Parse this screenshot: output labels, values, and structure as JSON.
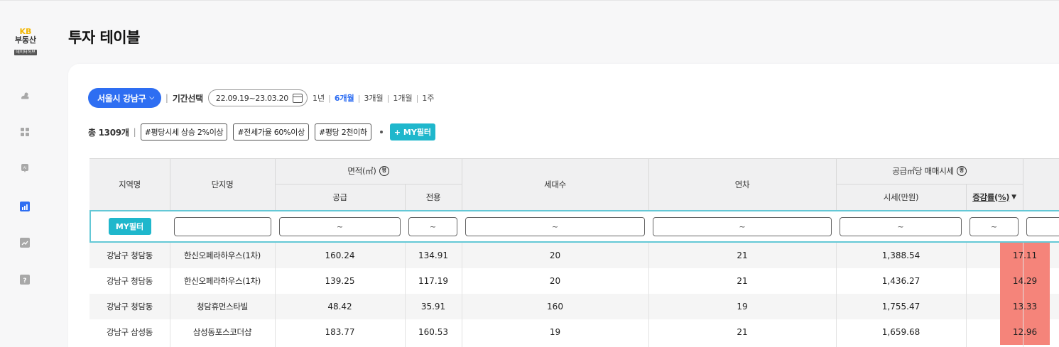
{
  "logo": {
    "line1": "KB",
    "line2": "부동산",
    "line3": "데이터허브"
  },
  "nav_icons": [
    "weather-icon",
    "grid-icon",
    "ai-icon",
    "chart-bar-icon",
    "trend-icon",
    "question-icon"
  ],
  "title": "투자 테이블",
  "filters": {
    "region": "서울시 강남구",
    "period_label": "기간선택",
    "date_range": "22.09.19~23.03.20",
    "periods": [
      {
        "label": "1년",
        "active": false
      },
      {
        "label": "6개월",
        "active": true
      },
      {
        "label": "3개월",
        "active": false
      },
      {
        "label": "1개월",
        "active": false
      },
      {
        "label": "1주",
        "active": false
      }
    ]
  },
  "tags_row": {
    "total": "총 1309개",
    "tags": [
      "#평당시세 상승 2%이상",
      "#전세가율 60%이상",
      "#평당 2천이하"
    ],
    "my_filter": "+ MY필터"
  },
  "table": {
    "headers": {
      "region": "지역명",
      "complex": "단지명",
      "area": "면적(㎡)",
      "area_supply": "공급",
      "area_exclusive": "전용",
      "households": "세대수",
      "age": "연차",
      "price_group": "공급㎡당 매매시세",
      "price": "시세(만원)",
      "change": "증감률(%)",
      "sort_arrow": "▼"
    },
    "filter_row": {
      "my_filter_button": "MY필터",
      "tilde": "~"
    },
    "rows": [
      {
        "region": "강남구 청담동",
        "complex": "한신오페라하우스(1차)",
        "supply": "160.24",
        "exclusive": "134.91",
        "households": "20",
        "age": "21",
        "price": "1,388.54",
        "change": "17.11"
      },
      {
        "region": "강남구 청담동",
        "complex": "한신오페라하우스(1차)",
        "supply": "139.25",
        "exclusive": "117.19",
        "households": "20",
        "age": "21",
        "price": "1,436.27",
        "change": "14.29"
      },
      {
        "region": "강남구 청담동",
        "complex": "청담휴먼스타빌",
        "supply": "48.42",
        "exclusive": "35.91",
        "households": "160",
        "age": "19",
        "price": "1,755.47",
        "change": "13.33"
      },
      {
        "region": "강남구 삼성동",
        "complex": "삼성동포스코더샵",
        "supply": "183.77",
        "exclusive": "160.53",
        "households": "19",
        "age": "21",
        "price": "1,659.68",
        "change": "12.96"
      }
    ]
  },
  "colors": {
    "accent": "#2e6ef2",
    "teal": "#1fb7cc",
    "highlight": "#f5847a"
  }
}
